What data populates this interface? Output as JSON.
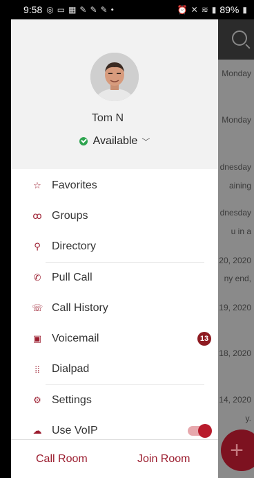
{
  "status_bar": {
    "time": "9:58",
    "battery": "89%"
  },
  "background": {
    "items": [
      "Monday",
      "Monday",
      "dnesday",
      "aining",
      "dnesday",
      "u in a",
      "20, 2020",
      "ny end,",
      "19, 2020",
      "18, 2020",
      "14, 2020",
      "y."
    ]
  },
  "profile": {
    "name": "Tom N",
    "presence": "Available"
  },
  "menu": {
    "items": [
      {
        "label": "Favorites",
        "icon": "star-icon"
      },
      {
        "label": "Groups",
        "icon": "groups-icon"
      },
      {
        "label": "Directory",
        "icon": "search-icon"
      },
      {
        "label": "Pull Call",
        "icon": "pull-call-icon"
      },
      {
        "label": "Call History",
        "icon": "call-history-icon"
      },
      {
        "label": "Voicemail",
        "icon": "voicemail-icon",
        "badge": "13"
      },
      {
        "label": "Dialpad",
        "icon": "dialpad-icon"
      },
      {
        "label": "Settings",
        "icon": "gear-icon"
      },
      {
        "label": "Use VoIP",
        "icon": "cloud-icon",
        "toggle": true
      }
    ]
  },
  "footer": {
    "left": "Call Room",
    "right": "Join Room"
  },
  "colors": {
    "accent": "#9b1c2e",
    "presence": "#2ea44f",
    "badge": "#8e1b22"
  }
}
